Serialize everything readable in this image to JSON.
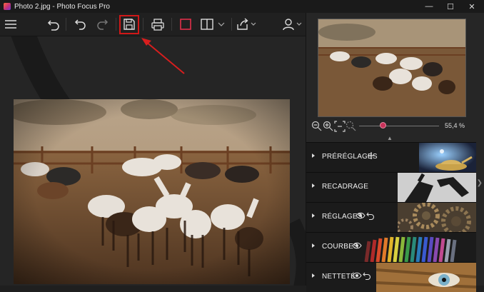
{
  "window": {
    "title": "Photo 2.jpg - Photo Focus Pro",
    "minimize": "—",
    "maximize": "☐",
    "close": "✕"
  },
  "toolbar": {
    "buttons": [
      "menu-icon",
      "undo-icon",
      "redo-icon",
      "redo-disabled-icon",
      "save-icon",
      "print-icon",
      "crop-frame-icon",
      "split-view-icon",
      "export-icon",
      "user-icon"
    ],
    "highlight_color": "#d01818"
  },
  "preview": {
    "zoom_value": "55,4 %",
    "slider_fraction": 0.3
  },
  "sections": [
    {
      "label": "PRÉRÉGLAGES",
      "icon": "plus-icon"
    },
    {
      "label": "RECADRAGE",
      "icon": ""
    },
    {
      "label": "RÉGLAGES",
      "icon": "eye-icon"
    },
    {
      "label": "COURBES",
      "icon": "eye-icon"
    },
    {
      "label": "NETTETÉ",
      "icon": "eye-icon"
    }
  ],
  "colors": {
    "accent": "#c8325a",
    "panel_bg": "#262626",
    "toolbar_bg": "#202020"
  }
}
